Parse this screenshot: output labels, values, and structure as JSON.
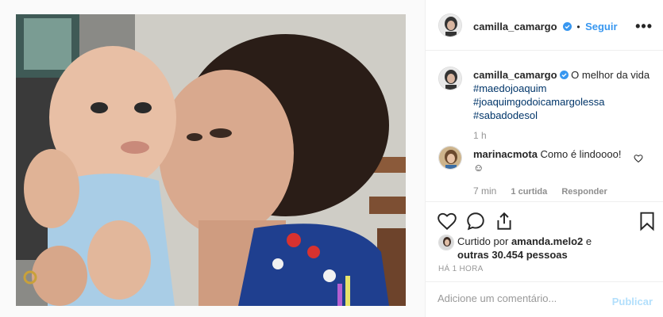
{
  "post": {
    "author": "camilla_camargo",
    "follow_label": "Seguir",
    "follow_separator": "•",
    "more_icon": "more-horizontal-icon"
  },
  "caption": {
    "author": "camilla_camargo",
    "text": "O melhor da vida",
    "hashtags": [
      "#maedojoaquim",
      "#joaquimgodoicamargolessa",
      "#sabadodesol"
    ],
    "time": "1 h"
  },
  "comment": {
    "author": "marinacmota",
    "text": "Como é lindoooo!",
    "emoji": "☺",
    "time": "7 min",
    "likes": "1 curtida",
    "reply_label": "Responder"
  },
  "likes": {
    "prefix": "Curtido por",
    "user": "amanda.melo2",
    "connector": "e",
    "others": "outras 30.454 pessoas"
  },
  "posted_ago": "HÁ 1 HORA",
  "add_comment": {
    "placeholder": "Adicione um comentário...",
    "publish_label": "Publicar"
  },
  "colors": {
    "link": "#3897f0",
    "hashtag": "#003569",
    "publish_disabled": "#b2dffc",
    "verified": "#3897f0"
  }
}
